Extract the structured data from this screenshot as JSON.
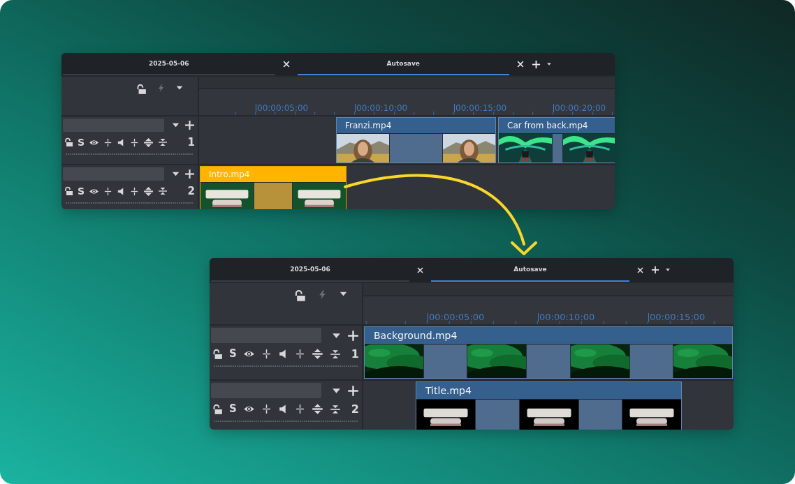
{
  "panels": [
    {
      "tabs": [
        {
          "label": "2025-05-06",
          "selected": false
        },
        {
          "label": "Autosave",
          "selected": true
        }
      ],
      "ruler": [
        "00:00:05:00",
        "00:00:10:00",
        "00:00:15:00",
        "00:00:20:00"
      ],
      "tracks": [
        {
          "solo": "S",
          "number": "1",
          "clips": [
            {
              "name": "Franzi.mp4",
              "selected": false,
              "frames": [
                {
                  "kind": "picture"
                },
                {
                  "kind": "gap"
                },
                {
                  "kind": "picture"
                }
              ]
            },
            {
              "name": "Car from back.mp4",
              "selected": false,
              "frames": [
                {
                  "kind": "picture"
                },
                {
                  "kind": "gap"
                },
                {
                  "kind": "picture"
                }
              ]
            }
          ]
        },
        {
          "solo": "S",
          "number": "2",
          "clips": [
            {
              "name": "Intro.mp4",
              "selected": true,
              "frames": [
                {
                  "kind": "picture"
                },
                {
                  "kind": "gap"
                },
                {
                  "kind": "picture"
                }
              ]
            }
          ]
        }
      ]
    },
    {
      "tabs": [
        {
          "label": "2025-05-06",
          "selected": false
        },
        {
          "label": "Autosave",
          "selected": true
        }
      ],
      "ruler": [
        "00:00:05:00",
        "00:00:10:00",
        "00:00:15:00"
      ],
      "tracks": [
        {
          "solo": "S",
          "number": "1",
          "clips": [
            {
              "name": "Background.mp4",
              "selected": false,
              "frames": [
                {
                  "kind": "picture"
                },
                {
                  "kind": "gap"
                },
                {
                  "kind": "picture"
                },
                {
                  "kind": "gap"
                },
                {
                  "kind": "picture"
                },
                {
                  "kind": "gap"
                },
                {
                  "kind": "picture"
                }
              ]
            }
          ]
        },
        {
          "solo": "S",
          "number": "2",
          "clips": [
            {
              "name": "Title.mp4",
              "selected": false,
              "frames": [
                {
                  "kind": "picture"
                },
                {
                  "kind": "gap"
                },
                {
                  "kind": "picture"
                },
                {
                  "kind": "gap"
                },
                {
                  "kind": "picture"
                }
              ]
            }
          ]
        }
      ]
    }
  ]
}
